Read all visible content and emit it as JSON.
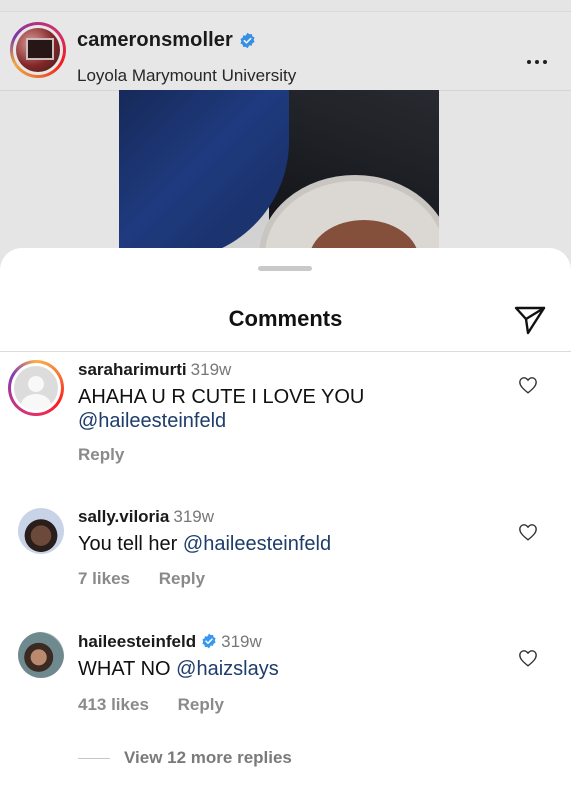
{
  "post": {
    "username": "cameronsmoller",
    "location": "Loyola Marymount University",
    "verified": true
  },
  "sheet": {
    "title": "Comments"
  },
  "comments": [
    {
      "username": "saraharimurti",
      "time": "319w",
      "text": "AHAHA U R CUTE I LOVE YOU",
      "mention": "@haileesteinfeld",
      "likes": "",
      "reply_label": "Reply"
    },
    {
      "username": "sally.viloria",
      "time": "319w",
      "text": "You tell her",
      "mention": "@haileesteinfeld",
      "likes": "7 likes",
      "reply_label": "Reply"
    },
    {
      "username": "haileesteinfeld",
      "verified": true,
      "time": "319w",
      "text": "WHAT NO",
      "mention": "@haizslays",
      "likes": "413 likes",
      "reply_label": "Reply"
    }
  ],
  "view_more_label": "View 12 more replies",
  "colors": {
    "mention": "#1e3d6b",
    "verified": "#3897f0",
    "muted": "#8a8a8a"
  }
}
